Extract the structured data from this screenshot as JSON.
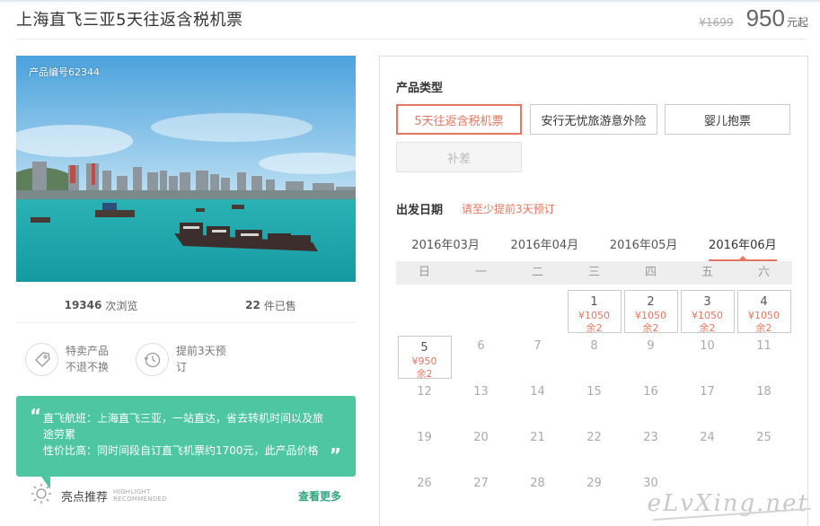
{
  "header": {
    "title": "上海直飞三亚5天往返含税机票",
    "old_price": "¥1699",
    "price": "950",
    "price_unit": "元起"
  },
  "product": {
    "number_label": "产品编号62344",
    "views_count": "19346",
    "views_label": "次浏览",
    "sold_count": "22",
    "sold_label": "件已售"
  },
  "features": [
    {
      "icon": "tag-icon",
      "line1": "特卖产品",
      "line2": "不退不换"
    },
    {
      "icon": "clock-history-icon",
      "line1": "提前3天预",
      "line2": "订"
    }
  ],
  "highlights": {
    "lines": [
      "直飞航班：上海直飞三亚，一站直达，省去转机时间以及旅",
      "途劳累",
      "性价比高：同时间段自订直飞机票约1700元，此产品价格"
    ],
    "rec_title": "亮点推荐",
    "rec_en_1": "HIGHLIGHT",
    "rec_en_2": "RECOMMENDED",
    "see_more": "查看更多"
  },
  "booking": {
    "type_label": "产品类型",
    "options": [
      "5天往返含税机票",
      "安行无忧旅游意外险",
      "婴儿抱票",
      "补差"
    ],
    "date_label": "出发日期",
    "date_tip": "请至少提前3天预订",
    "months": [
      "2016年03月",
      "2016年04月",
      "2016年05月",
      "2016年06月"
    ],
    "weekdays": [
      "日",
      "一",
      "二",
      "三",
      "四",
      "五",
      "六"
    ],
    "days": [
      {
        "num": "1",
        "price": "¥1050",
        "stock": "余2"
      },
      {
        "num": "2",
        "price": "¥1050",
        "stock": "余2"
      },
      {
        "num": "3",
        "price": "¥1050",
        "stock": "余2"
      },
      {
        "num": "4",
        "price": "¥1050",
        "stock": "余2"
      },
      {
        "num": "5",
        "price": "¥950",
        "stock": "余2"
      },
      {
        "num": "6"
      },
      {
        "num": "7"
      },
      {
        "num": "8"
      },
      {
        "num": "9"
      },
      {
        "num": "10"
      },
      {
        "num": "11"
      },
      {
        "num": "12"
      },
      {
        "num": "13"
      },
      {
        "num": "14"
      },
      {
        "num": "15"
      },
      {
        "num": "16"
      },
      {
        "num": "17"
      },
      {
        "num": "18"
      },
      {
        "num": "19"
      },
      {
        "num": "20"
      },
      {
        "num": "21"
      },
      {
        "num": "22"
      },
      {
        "num": "23"
      },
      {
        "num": "24"
      },
      {
        "num": "25"
      },
      {
        "num": "26"
      },
      {
        "num": "27"
      },
      {
        "num": "28"
      },
      {
        "num": "29"
      },
      {
        "num": "30"
      }
    ]
  },
  "watermark": "eLvXing.net"
}
